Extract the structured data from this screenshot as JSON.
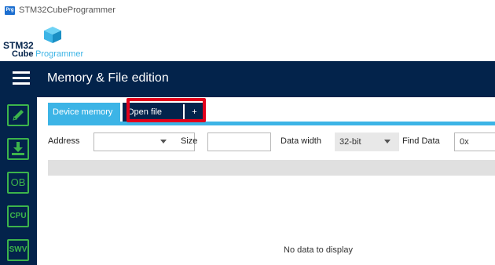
{
  "window": {
    "title": "STM32CubeProgrammer",
    "app_icon_text": "Prg"
  },
  "logo": {
    "stm": "STM32",
    "cube": "Cube",
    "programmer": "Programmer"
  },
  "header": {
    "title": "Memory & File edition"
  },
  "sidebar": {
    "items": [
      {
        "icon": "pencil-icon"
      },
      {
        "icon": "download-icon"
      },
      {
        "label": "OB"
      },
      {
        "label": "CPU"
      },
      {
        "label": "SWV"
      }
    ]
  },
  "tabs": {
    "device_memory": "Device memory",
    "open_file": "Open file",
    "add": "+"
  },
  "toolbar": {
    "address_label": "Address",
    "address_value": "",
    "size_label": "Size",
    "size_value": "",
    "data_width_label": "Data width",
    "data_width_value": "32-bit",
    "find_data_label": "Find Data",
    "find_data_value": "0x"
  },
  "grid": {
    "empty_message": "No data to display"
  },
  "colors": {
    "navy": "#03234b",
    "accent_blue": "#3cb4e6",
    "green": "#3cb44b",
    "highlight_red": "#e3001b"
  }
}
